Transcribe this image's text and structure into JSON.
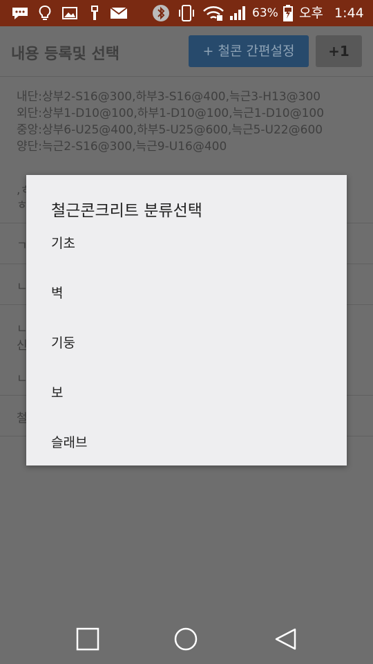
{
  "status_bar": {
    "battery_percent": "63%",
    "ampm": "오후",
    "time": "1:44"
  },
  "app": {
    "title": "내용 등록및 선택",
    "preset_button": "+ 철콘 간편설정",
    "plus_one_button": "+1"
  },
  "summary_lines": [
    "내단:상부2-S16@300,하부3-S16@400,늑근3-H13@300",
    "외단:상부1-D10@100,하부1-D10@100,늑근1-D10@100",
    "중앙:상부6-U25@400,하부5-U25@600,늑근5-U22@600",
    "양단:늑근2-S16@300,늑근9-U16@400"
  ],
  "background_rows": {
    "r1a": ",ㅎ",
    "r1b": "ㅎ",
    "r2": "ㄱ",
    "r3": "ㄴ",
    "r4a": "ㄴ",
    "r4b": "신",
    "r5": "ㄴ",
    "r6": "철"
  },
  "dialog": {
    "title": "철근콘크리트 분류선택",
    "options": [
      "기초",
      "벽",
      "기둥",
      "보",
      "슬래브"
    ]
  }
}
